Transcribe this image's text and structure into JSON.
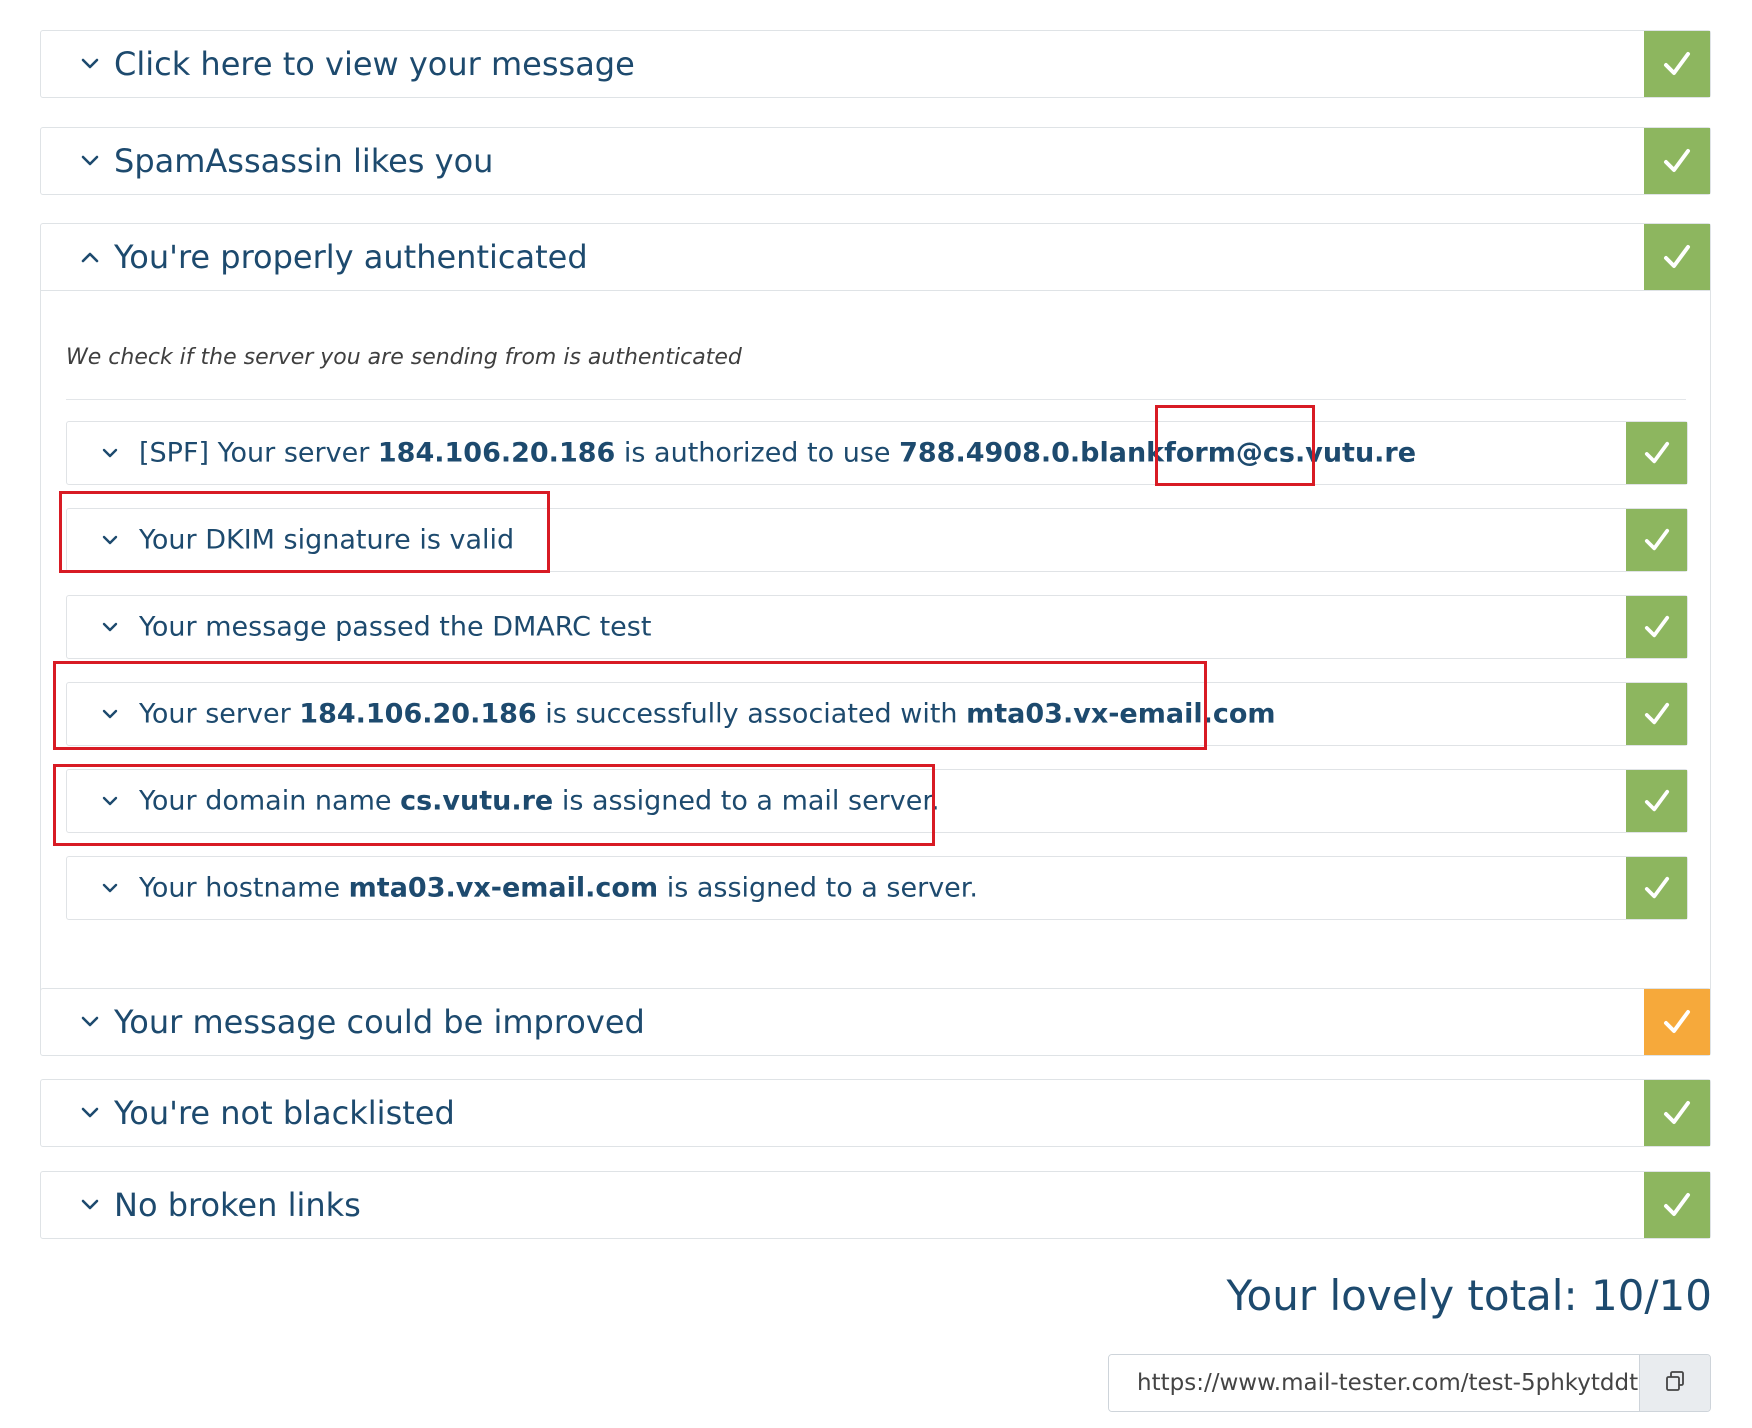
{
  "colors": {
    "pass": "#8db65f",
    "warning": "#f6a93b",
    "text": "#1d4a6e",
    "highlight": "#d81b24"
  },
  "sections": {
    "message": {
      "title": "Click here to view your message",
      "status": "pass",
      "icon": "chevron-down-icon"
    },
    "spamassassin": {
      "title": "SpamAssassin likes you",
      "status": "pass",
      "icon": "chevron-down-icon"
    },
    "authentication": {
      "title": "You're properly authenticated",
      "status": "pass",
      "icon": "chevron-up-icon",
      "intro": "We check if the server you are sending from is authenticated",
      "checks": {
        "spf": {
          "prefix": "[SPF] Your server ",
          "ip": "184.106.20.186",
          "middle": " is authorized to use ",
          "address": "788.4908.0.blankform@cs.vutu.re",
          "status": "pass"
        },
        "dkim": {
          "text": "Your DKIM signature is valid",
          "status": "pass"
        },
        "dmarc": {
          "text": "Your message passed the DMARC test",
          "status": "pass"
        },
        "reverse_dns": {
          "prefix": "Your server ",
          "ip": "184.106.20.186",
          "middle": " is successfully associated with ",
          "host": "mta03.vx-email.com",
          "status": "pass"
        },
        "mx": {
          "prefix": "Your domain name ",
          "domain": "cs.vutu.re",
          "suffix": " is assigned to a mail server.",
          "status": "pass"
        },
        "a_record": {
          "prefix": "Your hostname ",
          "host": "mta03.vx-email.com",
          "suffix": " is assigned to a server.",
          "status": "pass"
        }
      }
    },
    "improvement": {
      "title": "Your message could be improved",
      "status": "warning",
      "icon": "chevron-down-icon"
    },
    "blacklist": {
      "title": "You're not blacklisted",
      "status": "pass",
      "icon": "chevron-down-icon"
    },
    "links": {
      "title": "No broken links",
      "status": "pass",
      "icon": "chevron-down-icon"
    }
  },
  "total": {
    "label": "Your lovely total: 10/10"
  },
  "share": {
    "url": "https://www.mail-tester.com/test-5phkytddt",
    "copy_icon": "copy-icon"
  }
}
